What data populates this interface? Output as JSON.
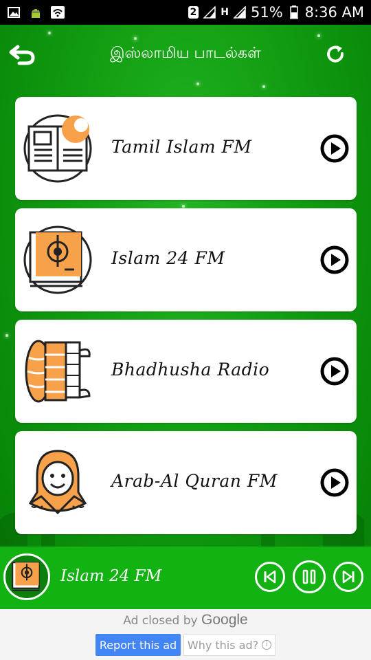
{
  "status_bar": {
    "sim_label": "2",
    "network_type": "H",
    "battery": "51%",
    "time": "8:36 AM",
    "icons": [
      "image-icon",
      "android-icon",
      "wifi-icon",
      "sim-icon",
      "signal-icon",
      "battery-icon"
    ]
  },
  "header": {
    "title": "இஸ்லாமிய பாடல்கள்",
    "back_icon": "back-arrow-icon",
    "refresh_icon": "refresh-icon"
  },
  "stations": [
    {
      "name": "Tamil Islam FM",
      "logo": "quran-book-icon"
    },
    {
      "name": "Islam 24 FM",
      "logo": "prayer-book-icon"
    },
    {
      "name": "Bhadhusha Radio",
      "logo": "prayer-mat-icon"
    },
    {
      "name": "Arab-Al Quran FM",
      "logo": "hijab-woman-icon"
    }
  ],
  "player": {
    "now_playing": "Islam 24 FM",
    "controls": [
      "previous-icon",
      "pause-icon",
      "next-icon"
    ]
  },
  "ad": {
    "closed_text": "Ad closed by",
    "brand": "Google",
    "report_label": "Report this ad",
    "why_label": "Why this ad?",
    "info_glyph": "i"
  },
  "colors": {
    "green_bg": "#109c10",
    "player_bg": "#13b213",
    "accent_orange": "#f7a24a",
    "report_blue": "#4285f4"
  }
}
